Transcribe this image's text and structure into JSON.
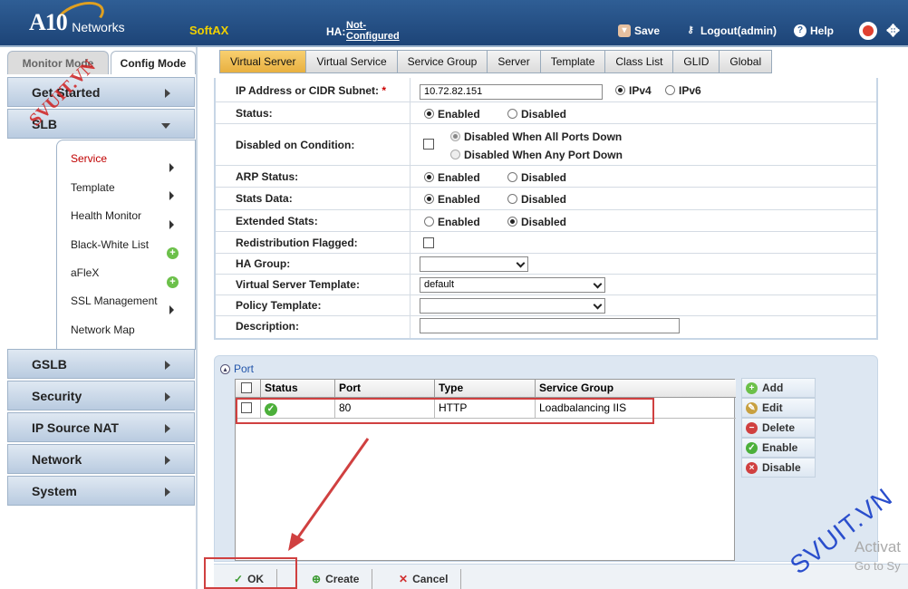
{
  "header": {
    "logo_main": "A10",
    "logo_sub": "Networks",
    "product": "SoftAX",
    "ha_label": "HA:",
    "ha_value": "Not-Configured",
    "save": "Save",
    "logout": "Logout(admin)",
    "help": "Help"
  },
  "mode_tabs": {
    "monitor": "Monitor Mode",
    "config": "Config Mode"
  },
  "sidebar": {
    "items": [
      {
        "label": "Get Started"
      },
      {
        "label": "SLB"
      },
      {
        "label": "GSLB"
      },
      {
        "label": "Security"
      },
      {
        "label": "IP Source NAT"
      },
      {
        "label": "Network"
      },
      {
        "label": "System"
      }
    ],
    "slb_sub": [
      {
        "label": "Service",
        "active": true
      },
      {
        "label": "Template"
      },
      {
        "label": "Health Monitor"
      },
      {
        "label": "Black-White List"
      },
      {
        "label": "aFleX"
      },
      {
        "label": "SSL Management"
      },
      {
        "label": "Network Map"
      }
    ]
  },
  "tabs": [
    "Virtual Server",
    "Virtual Service",
    "Service Group",
    "Server",
    "Template",
    "Class List",
    "GLID",
    "Global"
  ],
  "form": {
    "ip": {
      "label": "IP Address or CIDR Subnet:",
      "req": "*",
      "value": "10.72.82.151",
      "ipv4": "IPv4",
      "ipv6": "IPv6"
    },
    "status": {
      "label": "Status:",
      "enabled": "Enabled",
      "disabled": "Disabled"
    },
    "disabled_on_condition": {
      "label": "Disabled on Condition:",
      "opt1": "Disabled When All Ports Down",
      "opt2": "Disabled When Any Port Down"
    },
    "arp_status": {
      "label": "ARP Status:",
      "enabled": "Enabled",
      "disabled": "Disabled"
    },
    "stats_data": {
      "label": "Stats Data:",
      "enabled": "Enabled",
      "disabled": "Disabled"
    },
    "extended_stats": {
      "label": "Extended Stats:",
      "enabled": "Enabled",
      "disabled": "Disabled"
    },
    "redistribution": {
      "label": "Redistribution Flagged:"
    },
    "ha_group": {
      "label": "HA Group:",
      "value": ""
    },
    "vs_template": {
      "label": "Virtual Server Template:",
      "value": "default"
    },
    "policy_template": {
      "label": "Policy Template:",
      "value": ""
    },
    "description": {
      "label": "Description:",
      "value": ""
    }
  },
  "port": {
    "title": "Port",
    "columns": [
      "Status",
      "Port",
      "Type",
      "Service Group"
    ],
    "rows": [
      {
        "port": "80",
        "type": "HTTP",
        "service_group": "Loadbalancing IIS"
      }
    ],
    "actions": [
      "Add",
      "Edit",
      "Delete",
      "Enable",
      "Disable"
    ]
  },
  "footer": {
    "ok": "OK",
    "create": "Create",
    "cancel": "Cancel"
  },
  "watermarks": {
    "svuit": "SVUIT.VN",
    "logo": "SVUIT.VN",
    "activate": "Activat",
    "activate2": "Go to Sy"
  },
  "colors": {
    "header_bg": "#1d4477",
    "active_tab": "#e8b040",
    "highlight": "#d04040",
    "accent_green": "#4caf3a"
  }
}
